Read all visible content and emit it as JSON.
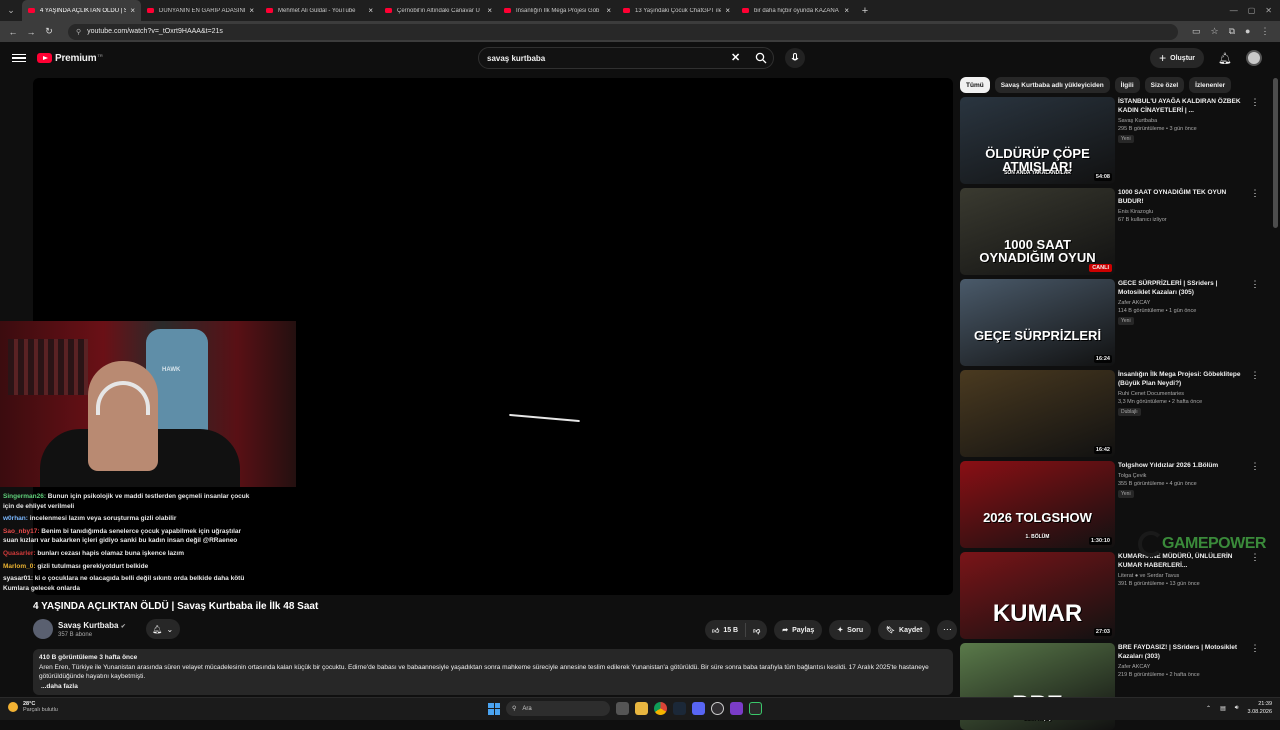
{
  "browser": {
    "tabs": [
      {
        "title": "4 YAŞINDA AÇLIKTAN ÖLDÜ | S",
        "active": true
      },
      {
        "title": "DÜNYANIN EN GARİP ADASINI"
      },
      {
        "title": "Mehmet Ali Güldal - YouTube"
      },
      {
        "title": "Çernobil'in Altındaki Canavar U"
      },
      {
        "title": "İnsanlığın İlk Mega Projesi Göb"
      },
      {
        "title": "13 Yaşındaki Çocuk ChatGPT ile"
      },
      {
        "title": "bir daha hiçbir oyunda KAZANA"
      }
    ],
    "url": "youtube.com/watch?v=_tOxrt9HAAA&t=21s"
  },
  "header": {
    "logo": "Premium",
    "logo_sup": "TR",
    "search_value": "savaş kurtbaba",
    "create_label": "Oluştur"
  },
  "chat": [
    {
      "user": "Singerman26:",
      "text": " Bunun için psikolojik ve maddi testlerden geçmeli insanlar çocuk için de ehliyet verilmeli",
      "color": "#5fcf7a"
    },
    {
      "user": "w0rhan:",
      "text": " incelenmesi lazım veya soruşturma gizli olabilir",
      "color": "#7ab8ff"
    },
    {
      "user": "Sao_nby17:",
      "text": " Benim bi tanıdığımda senelerce çocuk yapabilmek için uğraştılar suan kızları var bakarken içleri gidiyo sanki bu kadın insan değil @RRaeneo",
      "color": "#e84a4a"
    },
    {
      "user": "Quasarler:",
      "text": " bunları cezası hapis olamaz buna işkence lazım",
      "color": "#d23b3b"
    },
    {
      "user": "Marlom_0:",
      "text": " gizli tutulması gerekiyotdurt belkide",
      "color": "#e8b030"
    },
    {
      "user": "syasar01:",
      "text": " ki o çocuklara ne olacagıda belli değil sıkıntı orda belkide daha kötü Kumlara gelecek onlarda",
      "color": "#f0f0f0"
    }
  ],
  "video": {
    "title": "4 YAŞINDA AÇLIKTAN ÖLDÜ | Savaş Kurtbaba ile İlk 48 Saat",
    "channel": "Savaş Kurtbaba",
    "subs": "357 B abone",
    "likes": "15 B",
    "share": "Paylaş",
    "ask": "Soru",
    "save": "Kaydet",
    "meta": "410 B görüntüleme  3 hafta önce",
    "description": "Aren Eren, Türkiye ile Yunanistan arasında süren velayet mücadelesinin ortasında kalan küçük bir çocuktu. Edirne'de babası ve babaannesiyle yaşadıktan sonra mahkeme süreciyle annesine teslim edilerek Yunanistan'a götürüldü. Bir süre sonra baba tarafıyla tüm bağlantısı kesildi. 17 Aralık 2025'te hastaneye götürüldüğünde hayatını kaybetmişti.",
    "more": "...daha fazla"
  },
  "chips": [
    "Tümü",
    "Savaş Kurtbaba adlı yükleyiciden",
    "İlgili",
    "Size özel",
    "İzlenenler"
  ],
  "recommendations": [
    {
      "title": "İSTANBUL'U AYAĞA KALDIRAN ÖZBEK KADIN CİNAYETLERİ | ...",
      "channel": "Savaş Kurtbaba",
      "meta": "295 B görüntüleme • 3 gün önce",
      "badge": "Yeni",
      "duration": "54:08",
      "overlay": "ÖLDÜRÜP ÇÖPE ATMIŞLAR!",
      "overlay_sub": "SON ANDA YAKALANDILAR",
      "bg": "#2a3540"
    },
    {
      "title": "1000 SAAT OYNADIĞIM TEK OYUN BUDUR!",
      "channel": "Enis Kirazoglu",
      "meta": "67 B kullanıcı izliyor",
      "badge": "",
      "duration": "CANLI",
      "overlay": "1000 SAAT OYNADIĞIM OYUN",
      "overlay_sub": "",
      "bg": "#3a3a30"
    },
    {
      "title": "GECE SÜRPRİZLERİ | SSriders | Motosiklet Kazaları (305)",
      "channel": "Zafer AKCAY",
      "meta": "114 B görüntüleme • 1 gün önce",
      "badge": "Yeni",
      "duration": "16:24",
      "overlay": "GEÇE SÜRPRİZLERİ",
      "overlay_sub": "",
      "bg": "#4a5a6a"
    },
    {
      "title": "İnsanlığın İlk Mega Projesi: Göbeklitepe (Büyük Plan Neydi?)",
      "channel": "Ruhi Cenet Documentaries",
      "meta": "3,3 Mn görüntüleme • 2 hafta önce",
      "badge": "Dublajlı",
      "duration": "16:42",
      "overlay": "",
      "overlay_sub": "",
      "bg": "#4a3a20"
    },
    {
      "title": "Tolgshow Yıldızlar 2026 1.Bölüm",
      "channel": "Tolga Çevik",
      "meta": "355 B görüntüleme • 4 gün önce",
      "badge": "Yeni",
      "duration": "1:30:10",
      "overlay": "2026 TOLGSHOW",
      "overlay_sub": "1. BÖLÜM",
      "bg": "#8a0f14"
    },
    {
      "title": "KUMARHANE MÜDÜRÜ, ÜNLÜLERİN KUMAR HABERLERİ...",
      "channel": "Literat ● ve Serdar Tavus",
      "meta": "391 B görüntüleme • 13 gün önce",
      "badge": "",
      "duration": "27:03",
      "overlay": "KUMAR",
      "overlay_sub": "",
      "bg": "#7a1418"
    },
    {
      "title": "BRE FAYDASIZ! | SSriders | Motosiklet Kazaları (303)",
      "channel": "Zafer AKCAY",
      "meta": "219 B görüntüleme • 2 hafta önce",
      "badge": "",
      "duration": "",
      "overlay": "BRE",
      "overlay_sub": "Zafer Akçay",
      "bg": "#5a7a4a"
    }
  ],
  "watermark": "GAMEPOWER",
  "webcam": {
    "chair_label": "HAWK"
  },
  "taskbar": {
    "temp": "28°C",
    "weather": "Parçalı bulutlu",
    "search": "Ara",
    "time": "21:39",
    "date": "3.08.2026"
  }
}
